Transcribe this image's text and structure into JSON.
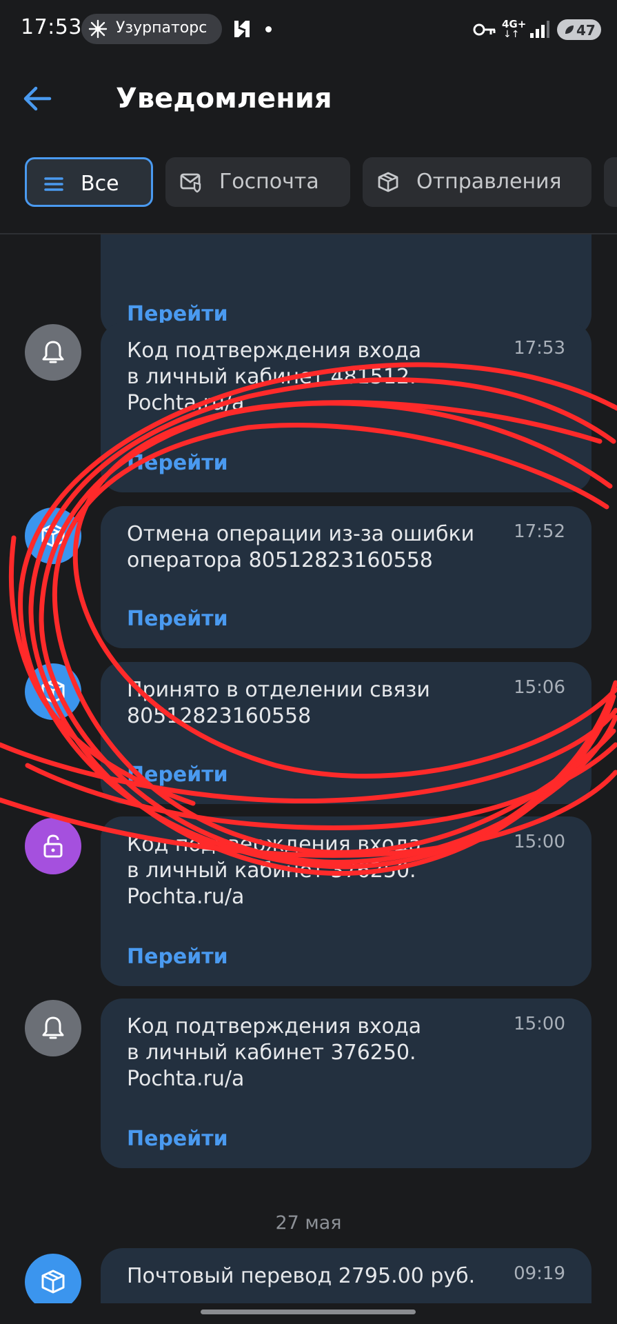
{
  "status_bar": {
    "time": "17:53",
    "notification_pill": "Узурпаторс",
    "network": "4G+",
    "network_arrows": "↓↑",
    "battery": "47"
  },
  "header": {
    "title": "Уведомления"
  },
  "tabs": [
    {
      "label": "Все",
      "icon": "menu-lines-icon",
      "active": true
    },
    {
      "label": "Госпочта",
      "icon": "mail-shield-icon",
      "active": false
    },
    {
      "label": "Отправления",
      "icon": "parcel-icon",
      "active": false
    }
  ],
  "notifications": [
    {
      "icon": "bell-icon",
      "text": "",
      "time": "",
      "link": "Перейти"
    },
    {
      "icon": "bell-icon",
      "text": "Код подтверждения входа\nв личный кабинет 481512.\nPochta.ru/a",
      "time": "17:53",
      "link": "Перейти"
    },
    {
      "icon": "parcel-icon",
      "text": "Отмена операции из-за ошибки\nоператора 80512823160558",
      "time": "17:52",
      "link": "Перейти"
    },
    {
      "icon": "parcel-icon",
      "text": "Принято в отделении связи\n80512823160558",
      "time": "15:06",
      "link": "Перейти"
    },
    {
      "icon": "lock-icon",
      "text": "Код подтверждения входа\nв личный кабинет 376250.\nPochta.ru/a",
      "time": "15:00",
      "link": "Перейти"
    },
    {
      "icon": "bell-icon",
      "text": "Код подтверждения входа\nв личный кабинет 376250.\nPochta.ru/a",
      "time": "15:00",
      "link": "Перейти"
    },
    {
      "icon": "parcel-icon",
      "text": "Почтовый перевод 2795.00 руб.",
      "time": "09:19",
      "link": ""
    }
  ],
  "date_separator": "27 мая",
  "colors": {
    "background": "#1a1b1d",
    "card": "#23303f",
    "accent": "#4a9af0",
    "bell_avatar": "#6b6f76",
    "parcel_avatar": "#3b95ee",
    "lock_avatar": "#a550de",
    "scribble": "#ff2a2a"
  }
}
